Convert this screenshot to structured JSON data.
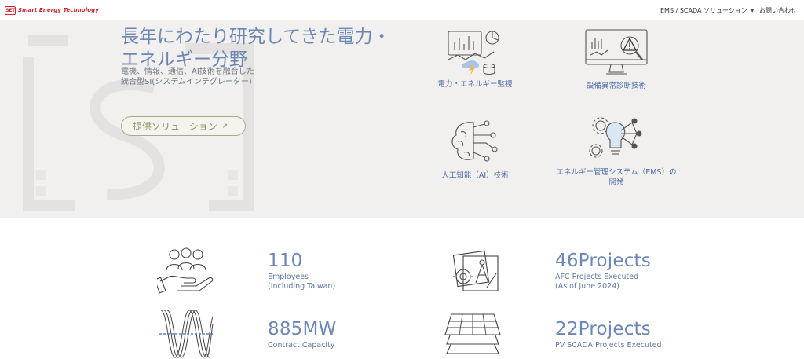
{
  "header": {
    "logo_mark": "SET",
    "logo_text": "Smart Energy Technology",
    "nav_dropdown": "EMS / SCADA ソリューション",
    "nav_contact": "お問い合わせ"
  },
  "hero": {
    "title_line1": "長年にわたり研究してきた電力・",
    "title_line2": "エネルギー分野",
    "subtitle_line1": "電機、情報、通信、AI技術を融合した",
    "subtitle_line2": "統合型SI(システムインテグレーター)",
    "button_label": "提供ソリューション",
    "button_arrow": "↗",
    "features": [
      {
        "label": "電力・エネルギー監視",
        "icon": "power-monitoring-icon"
      },
      {
        "label": "設備異常診断技術",
        "icon": "anomaly-diagnosis-icon"
      },
      {
        "label": "人工知能（AI）技術",
        "icon": "ai-brain-icon"
      },
      {
        "label_line1": "エネルギー管理システム（EMS）の",
        "label_line2": "開発",
        "icon": "ems-bulb-icon"
      }
    ]
  },
  "stats": [
    {
      "value": "110",
      "desc_line1": "Employees",
      "desc_line2": "(Including Taiwan)",
      "icon": "employees-icon"
    },
    {
      "value": "46Projects",
      "desc_line1": "AFC Projects Executed",
      "desc_line2": "(As of June 2024)",
      "icon": "engineering-icon"
    },
    {
      "value": "885MW",
      "desc_line1": "Contract Capacity",
      "desc_line2": "",
      "icon": "waveform-icon"
    },
    {
      "value": "22Projects",
      "desc_line1": "PV SCADA Projects Executed",
      "desc_line2": "",
      "icon": "solar-panel-icon"
    }
  ],
  "colors": {
    "accent": "#6c86b6",
    "hero_bg": "#f1f0ef",
    "logo_red": "#d0202a",
    "button_olive": "#8d9660"
  }
}
